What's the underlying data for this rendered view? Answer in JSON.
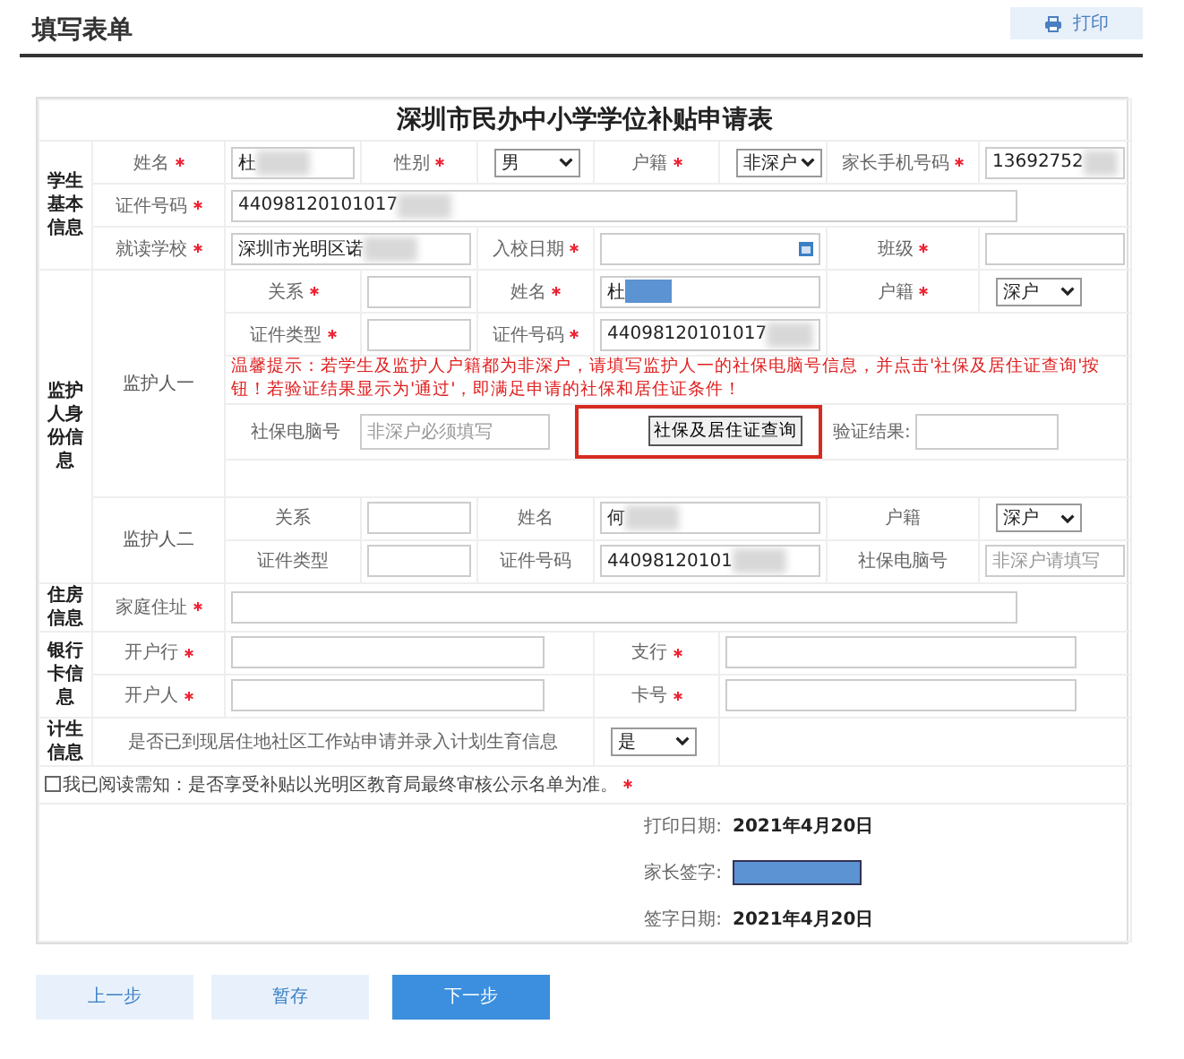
{
  "header": {
    "title": "填写表单",
    "print_button": "打印"
  },
  "form": {
    "title": "深圳市民办中小学学位补贴申请表",
    "sections": [
      {
        "kind": "plain",
        "label": "学生基本信息",
        "rows": [
          {
            "kind": "four_pairs",
            "pairs": [
              {
                "label": "姓名",
                "required": true,
                "field": {
                  "kind": "text",
                  "value": "杜",
                  "blurred": true
                }
              },
              {
                "label": "性别",
                "required": true,
                "field": {
                  "kind": "select",
                  "value": "男"
                }
              },
              {
                "label": "户籍",
                "required": true,
                "field": {
                  "kind": "select",
                  "value": "非深户"
                }
              },
              {
                "label": "家长手机号码",
                "required": true,
                "field": {
                  "kind": "text",
                  "value": "13692752",
                  "blurred": true
                }
              }
            ]
          },
          {
            "kind": "wide",
            "pairs": [
              {
                "label": "证件号码",
                "required": true,
                "field": {
                  "kind": "text",
                  "value": "44098120101017",
                  "blurred": true
                }
              }
            ]
          },
          {
            "kind": "school",
            "pairs": [
              {
                "label": "就读学校",
                "required": true,
                "field": {
                  "kind": "text",
                  "value": "深圳市光明区诺",
                  "blurred": true
                }
              },
              {
                "label": "入校日期",
                "required": true,
                "field": {
                  "kind": "date"
                }
              },
              {
                "label": "班级",
                "required": true,
                "field": {
                  "kind": "text"
                }
              }
            ]
          }
        ]
      },
      {
        "kind": "guardians",
        "label": "监护人身份信息",
        "guardians": [
          {
            "label": "监护人一",
            "rows": [
              {
                "kind": "guardian_pairs",
                "pairs": [
                  {
                    "label": "关系",
                    "required": true,
                    "field": {
                      "kind": "text"
                    }
                  },
                  {
                    "label": "姓名",
                    "required": true,
                    "field": {
                      "kind": "text",
                      "value": "杜",
                      "masked": true
                    }
                  },
                  {
                    "label": "户籍",
                    "required": true,
                    "field": {
                      "kind": "select",
                      "value": "深户"
                    }
                  }
                ]
              },
              {
                "kind": "guardian_pairs",
                "pairs": [
                  {
                    "label": "证件类型",
                    "required": true,
                    "field": {
                      "kind": "text"
                    }
                  },
                  {
                    "label": "证件号码",
                    "required": true,
                    "field": {
                      "kind": "text",
                      "value": "44098120101017",
                      "blurred": true
                    }
                  }
                ]
              },
              {
                "kind": "notice",
                "text": "温馨提示：若学生及监护人户籍都为非深户，请填写监护人一的社保电脑号信息，并点击'社保及居住证查询'按钮！若验证结果显示为'通过'，即满足申请的社保和居住证条件！"
              },
              {
                "kind": "query",
                "label": "社保电脑号",
                "field": {
                  "kind": "text",
                  "placeholder": "非深户必须填写"
                },
                "button": {
                  "label": "社保及居住证查询",
                  "highlighted": true
                },
                "result_label": "验证结果:",
                "result_field": {
                  "kind": "text"
                }
              },
              {
                "kind": "spacer"
              }
            ]
          },
          {
            "label": "监护人二",
            "rows": [
              {
                "kind": "guardian_pairs",
                "pairs": [
                  {
                    "label": "关系",
                    "required": false,
                    "field": {
                      "kind": "text"
                    }
                  },
                  {
                    "label": "姓名",
                    "required": false,
                    "field": {
                      "kind": "text",
                      "value": "何",
                      "blurred": true
                    }
                  },
                  {
                    "label": "户籍",
                    "required": false,
                    "field": {
                      "kind": "select",
                      "value": "深户"
                    }
                  }
                ]
              },
              {
                "kind": "guardian_pairs",
                "pairs": [
                  {
                    "label": "证件类型",
                    "required": false,
                    "field": {
                      "kind": "text"
                    }
                  },
                  {
                    "label": "证件号码",
                    "required": false,
                    "field": {
                      "kind": "text",
                      "value": "44098120101",
                      "blurred": true
                    }
                  },
                  {
                    "label": "社保电脑号",
                    "required": false,
                    "field": {
                      "kind": "text",
                      "placeholder": "非深户请填写"
                    }
                  }
                ]
              }
            ]
          }
        ]
      },
      {
        "kind": "plain",
        "label": "住房信息",
        "rows": [
          {
            "kind": "wide",
            "pairs": [
              {
                "label": "家庭住址",
                "required": true,
                "field": {
                  "kind": "text"
                }
              }
            ]
          }
        ]
      },
      {
        "kind": "plain",
        "label": "银行卡信息",
        "rows": [
          {
            "kind": "bank",
            "pairs": [
              {
                "label": "开户行",
                "required": true,
                "field": {
                  "kind": "text"
                }
              },
              {
                "label": "支行",
                "required": true,
                "field": {
                  "kind": "text"
                }
              }
            ]
          },
          {
            "kind": "bank",
            "pairs": [
              {
                "label": "开户人",
                "required": true,
                "field": {
                  "kind": "text"
                }
              },
              {
                "label": "卡号",
                "required": true,
                "field": {
                  "kind": "text"
                }
              }
            ]
          }
        ]
      },
      {
        "kind": "plain",
        "label": "计生信息",
        "rows": [
          {
            "kind": "question",
            "pairs": [
              {
                "label": "是否已到现居住地社区工作站申请并录入计划生育信息",
                "required": false,
                "field": {
                  "kind": "select",
                  "value": "是"
                }
              }
            ]
          }
        ]
      }
    ],
    "agreement": {
      "checked": false,
      "text": "我已阅读需知：是否享受补贴以光明区教育局最终审核公示名单为准。",
      "required": true
    },
    "signature": [
      {
        "label": "打印日期:",
        "kind": "text",
        "value": "2021年4月20日"
      },
      {
        "label": "家长签字:",
        "kind": "redacted"
      },
      {
        "label": "签字日期:",
        "kind": "text",
        "value": "2021年4月20日"
      }
    ]
  },
  "buttons": [
    {
      "label": "上一步",
      "primary": false
    },
    {
      "label": "暂存",
      "primary": false
    },
    {
      "label": "下一步",
      "primary": true
    }
  ]
}
